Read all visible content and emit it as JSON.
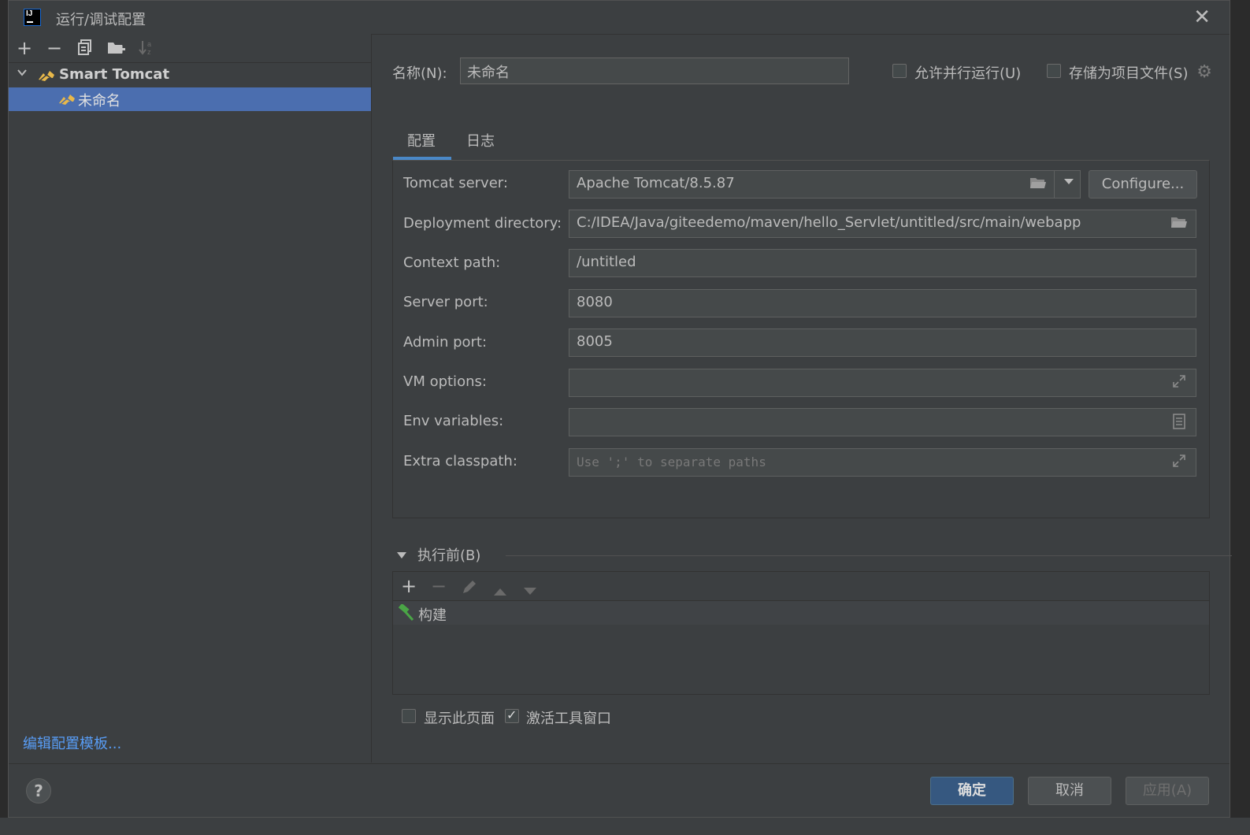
{
  "window": {
    "title": "运行/调试配置",
    "close_icon": "close-icon"
  },
  "left_toolbar": {
    "icons": [
      "add-icon",
      "remove-icon",
      "copy-icon",
      "new-folder-icon",
      "sort-icon"
    ]
  },
  "tree": {
    "group_label": "Smart Tomcat",
    "item_label": "未命名"
  },
  "edit_templates_link": "编辑配置模板...",
  "name_field": {
    "label": "名称(N):",
    "value": "未命名"
  },
  "options": {
    "allow_parallel": {
      "label": "允许并行运行(U)",
      "checked": false
    },
    "store_as_project_file": {
      "label": "存储为项目文件(S)",
      "checked": false
    }
  },
  "tabs": [
    {
      "label": "配置",
      "active": true
    },
    {
      "label": "日志",
      "active": false
    }
  ],
  "form": {
    "tomcat_server": {
      "label": "Tomcat server:",
      "value": "Apache Tomcat/8.5.87",
      "configure_label": "Configure..."
    },
    "deployment_directory": {
      "label": "Deployment directory:",
      "value": "C:/IDEA/Java/giteedemo/maven/hello_Servlet/untitled/src/main/webapp"
    },
    "context_path": {
      "label": "Context path:",
      "value": "/untitled"
    },
    "server_port": {
      "label": "Server port:",
      "value": "8080"
    },
    "admin_port": {
      "label": "Admin port:",
      "value": "8005"
    },
    "vm_options": {
      "label": "VM options:",
      "value": ""
    },
    "env_variables": {
      "label": "Env variables:",
      "value": ""
    },
    "extra_classpath": {
      "label": "Extra classpath:",
      "placeholder": "Use ';' to separate paths"
    }
  },
  "before_launch": {
    "label": "执行前(B)",
    "tasks": [
      {
        "label": "构建",
        "icon": "hammer-icon"
      }
    ]
  },
  "bottom_options": {
    "show_page": {
      "label": "显示此页面",
      "checked": false
    },
    "activate_tool_window": {
      "label": "激活工具窗口",
      "checked": true
    }
  },
  "footer": {
    "ok_label": "确定",
    "cancel_label": "取消",
    "apply_label": "应用(A)"
  },
  "colors": {
    "background": "#3c3f41",
    "selection": "#4b6eaf",
    "link": "#589df6",
    "ok_button": "#365880",
    "tab_underline": "#4a88c7"
  }
}
